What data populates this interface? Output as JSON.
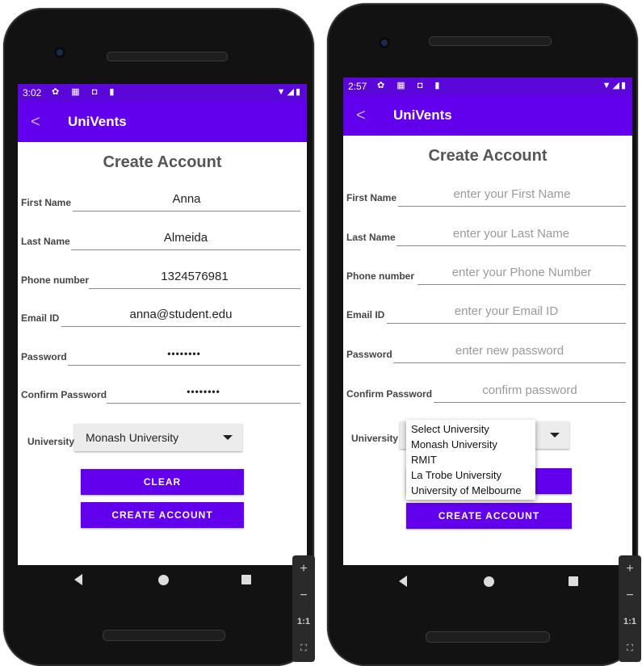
{
  "left": {
    "status": {
      "time": "3:02",
      "left_icons": "✿ ▦ ◘ ▮",
      "right_icons": "▼◢▮"
    },
    "app_title": "UniVents",
    "heading": "Create Account",
    "fields": [
      {
        "label": "First Name",
        "value": "Anna"
      },
      {
        "label": "Last Name",
        "value": "Almeida"
      },
      {
        "label": "Phone number",
        "value": "1324576981"
      },
      {
        "label": "Email ID",
        "value": "anna@student.edu"
      },
      {
        "label": "Password",
        "value": "••••••••"
      },
      {
        "label": "Confirm Password",
        "value": "••••••••"
      }
    ],
    "university_label": "University",
    "university_selected": "Monash University",
    "clear_label": "CLEAR",
    "create_label": "CREATE ACCOUNT"
  },
  "right": {
    "status": {
      "time": "2:57",
      "left_icons": "✿ ▦ ◘ ▮",
      "right_icons": "▼◢▮"
    },
    "app_title": "UniVents",
    "heading": "Create Account",
    "fields": [
      {
        "label": "First Name",
        "placeholder": "enter your First Name"
      },
      {
        "label": "Last Name",
        "placeholder": "enter your Last Name"
      },
      {
        "label": "Phone number",
        "placeholder": "enter your Phone Number"
      },
      {
        "label": "Email ID",
        "placeholder": "enter your Email ID"
      },
      {
        "label": "Password",
        "placeholder": "enter new password"
      },
      {
        "label": "Confirm Password",
        "placeholder": "confirm password"
      }
    ],
    "university_label": "University",
    "dropdown_options": [
      "Select University",
      "Monash University",
      "RMIT",
      "La Trobe University",
      "University of Melbourne"
    ],
    "create_label": "CREATE ACCOUNT"
  },
  "zoom": {
    "plus": "+",
    "minus": "−",
    "one_to_one": "1:1",
    "fit": "⛶"
  },
  "colors": {
    "primary": "#6200ee",
    "status_bar": "#5b07d9",
    "underline": "#8a8a8a"
  }
}
